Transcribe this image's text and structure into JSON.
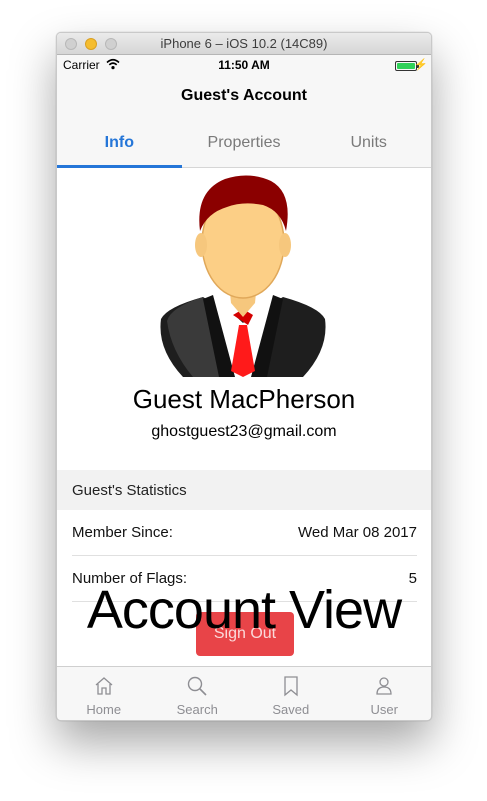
{
  "window": {
    "title": "iPhone 6 – iOS 10.2 (14C89)"
  },
  "statusbar": {
    "carrier": "Carrier",
    "time": "11:50 AM",
    "battery_color": "#2fd158"
  },
  "navbar": {
    "title": "Guest's Account"
  },
  "tabs": [
    {
      "label": "Info",
      "active": true
    },
    {
      "label": "Properties",
      "active": false
    },
    {
      "label": "Units",
      "active": false
    }
  ],
  "accent_color": "#2576d8",
  "profile": {
    "name": "Guest MacPherson",
    "email": "ghostguest23@gmail.com",
    "avatar_icon": "businessman-avatar-icon"
  },
  "statistics": {
    "header": "Guest's Statistics",
    "rows": [
      {
        "label": "Member Since:",
        "value": "Wed Mar 08 2017"
      },
      {
        "label": "Number of Flags:",
        "value": "5"
      }
    ]
  },
  "signout": {
    "label": "Sign Out",
    "color": "#e84448"
  },
  "overlay": {
    "text": "Account View"
  },
  "tabbar": {
    "items": [
      {
        "label": "Home",
        "icon": "home-icon"
      },
      {
        "label": "Search",
        "icon": "search-icon"
      },
      {
        "label": "Saved",
        "icon": "bookmark-icon"
      },
      {
        "label": "User",
        "icon": "user-icon"
      }
    ]
  }
}
